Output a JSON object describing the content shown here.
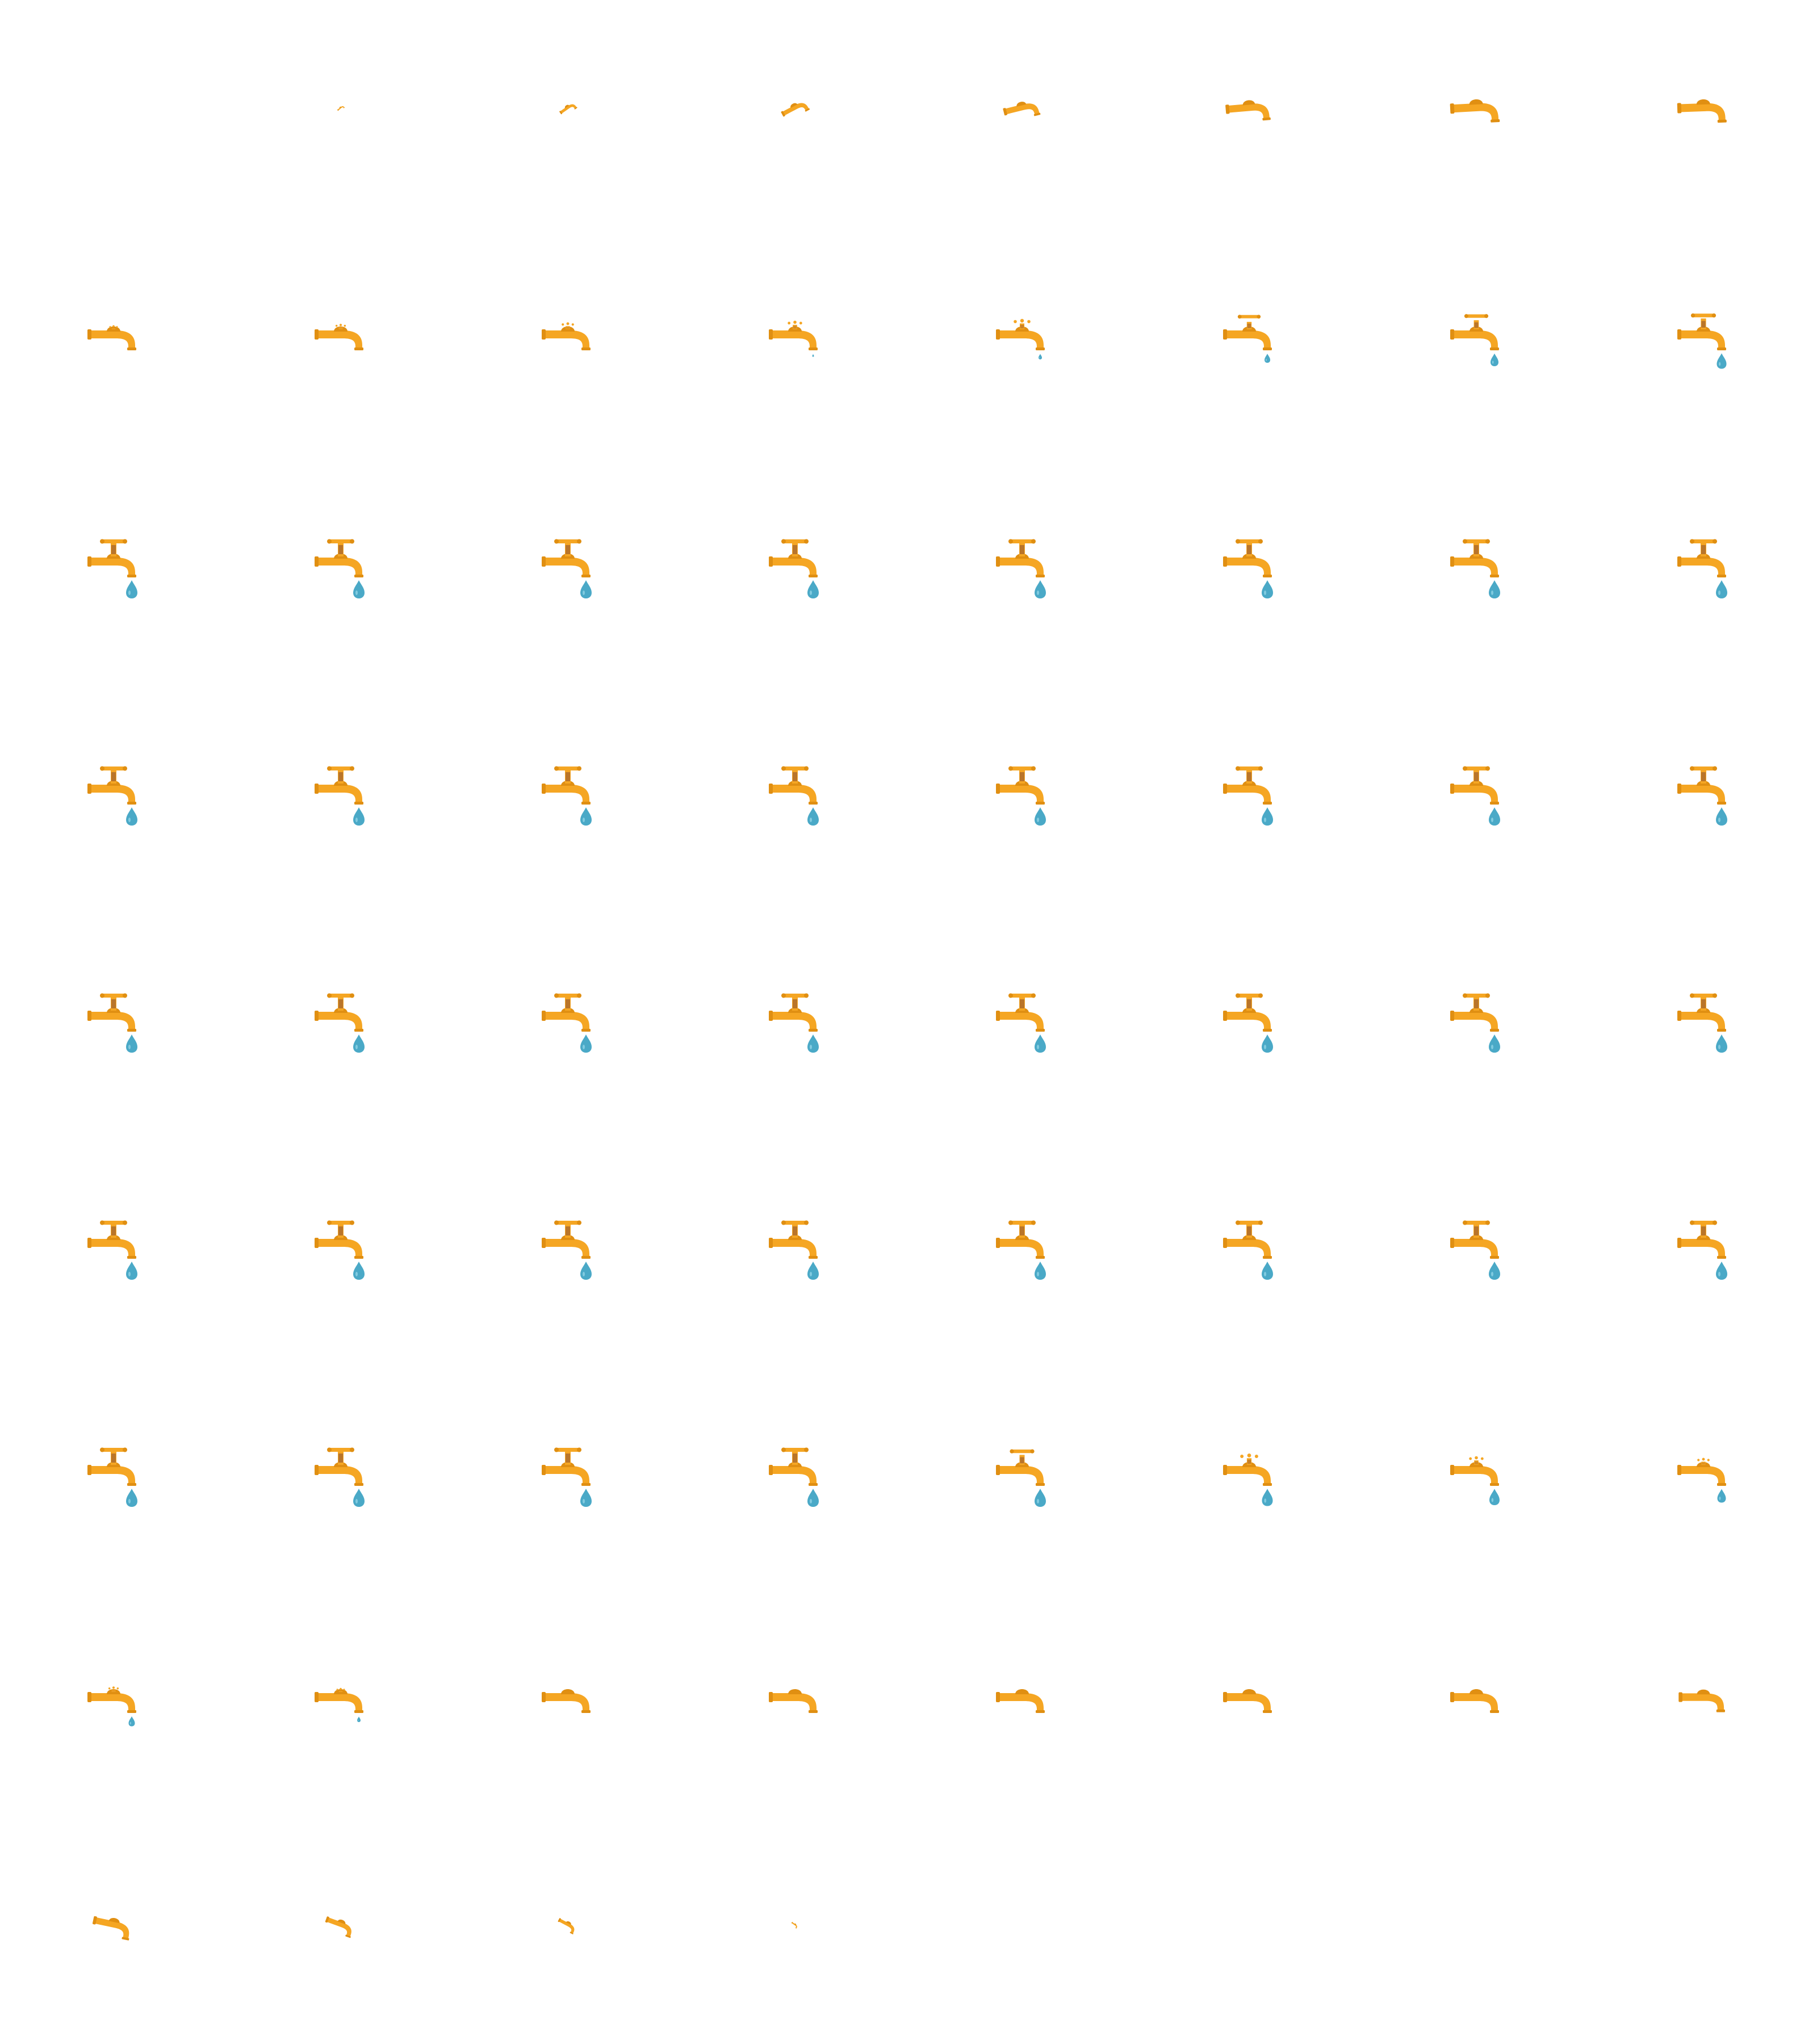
{
  "sprite_sheet": {
    "columns": 8,
    "rows": 9,
    "frame_count": 68,
    "colors": {
      "background": "#ffffff",
      "faucet_body": "#f5a623",
      "faucet_dark": "#e08f12",
      "valve_core": "#b9752b",
      "water": "#4aa9c7",
      "water_highlight": "#8fd3e6"
    },
    "phases": [
      {
        "name": "faucet-appears",
        "frames": [
          1,
          7
        ]
      },
      {
        "name": "valve-forms",
        "frames": [
          8,
          10
        ]
      },
      {
        "name": "drop-forms",
        "frames": [
          11,
          16
        ]
      },
      {
        "name": "steady-drip",
        "frames": [
          17,
          52
        ]
      },
      {
        "name": "drop-shrinks",
        "frames": [
          53,
          57
        ]
      },
      {
        "name": "faucet-disappears",
        "frames": [
          58,
          67
        ]
      }
    ],
    "frames": [
      {
        "n": 0,
        "scale": 0,
        "rot": -40,
        "handle": 0,
        "drop": 0
      },
      {
        "n": 1,
        "scale": 0.15,
        "rot": -40,
        "handle": 0,
        "drop": 0
      },
      {
        "n": 2,
        "scale": 0.35,
        "rot": -35,
        "handle": 0,
        "drop": 0
      },
      {
        "n": 3,
        "scale": 0.55,
        "rot": -28,
        "handle": 0,
        "drop": 0
      },
      {
        "n": 4,
        "scale": 0.72,
        "rot": -14,
        "handle": 0,
        "drop": 0
      },
      {
        "n": 5,
        "scale": 0.9,
        "rot": -5,
        "handle": 0,
        "drop": 0
      },
      {
        "n": 6,
        "scale": 1.0,
        "rot": -3,
        "handle": 0,
        "drop": 0
      },
      {
        "n": 7,
        "scale": 1.0,
        "rot": -2,
        "handle": 0,
        "drop": 0
      },
      {
        "n": 8,
        "scale": 1.0,
        "rot": 0,
        "handle": 0.1,
        "drop": 0
      },
      {
        "n": 9,
        "scale": 1.0,
        "rot": 0,
        "handle": 0.2,
        "drop": 0
      },
      {
        "n": 10,
        "scale": 1.0,
        "rot": 0,
        "handle": 0.3,
        "drop": 0
      },
      {
        "n": 11,
        "scale": 1.0,
        "rot": 0,
        "handle": 0.4,
        "drop": 0.15
      },
      {
        "n": 12,
        "scale": 1.0,
        "rot": 0,
        "handle": 0.5,
        "drop": 0.3
      },
      {
        "n": 13,
        "scale": 1.0,
        "rot": 0,
        "handle": 0.6,
        "drop": 0.5
      },
      {
        "n": 14,
        "scale": 1.0,
        "rot": 0,
        "handle": 0.7,
        "drop": 0.7
      },
      {
        "n": 15,
        "scale": 1.0,
        "rot": 0,
        "handle": 0.8,
        "drop": 0.85
      },
      {
        "n": 16,
        "scale": 1.0,
        "rot": 0,
        "handle": 1,
        "drop": 1
      },
      {
        "n": 17,
        "scale": 1.0,
        "rot": 0,
        "handle": 1,
        "drop": 1
      },
      {
        "n": 18,
        "scale": 1.0,
        "rot": 0,
        "handle": 1,
        "drop": 1
      },
      {
        "n": 19,
        "scale": 1.0,
        "rot": 0,
        "handle": 1,
        "drop": 1
      },
      {
        "n": 20,
        "scale": 1.0,
        "rot": 0,
        "handle": 1,
        "drop": 1
      },
      {
        "n": 21,
        "scale": 1.0,
        "rot": 0,
        "handle": 1,
        "drop": 1
      },
      {
        "n": 22,
        "scale": 1.0,
        "rot": 0,
        "handle": 1,
        "drop": 1
      },
      {
        "n": 23,
        "scale": 1.0,
        "rot": 0,
        "handle": 1,
        "drop": 1
      },
      {
        "n": 24,
        "scale": 1.0,
        "rot": 0,
        "handle": 1,
        "drop": 1
      },
      {
        "n": 25,
        "scale": 1.0,
        "rot": 0,
        "handle": 1,
        "drop": 1
      },
      {
        "n": 26,
        "scale": 1.0,
        "rot": 0,
        "handle": 1,
        "drop": 1
      },
      {
        "n": 27,
        "scale": 1.0,
        "rot": 0,
        "handle": 1,
        "drop": 1
      },
      {
        "n": 28,
        "scale": 1.0,
        "rot": 0,
        "handle": 1,
        "drop": 1
      },
      {
        "n": 29,
        "scale": 1.0,
        "rot": 0,
        "handle": 1,
        "drop": 1
      },
      {
        "n": 30,
        "scale": 1.0,
        "rot": 0,
        "handle": 1,
        "drop": 1
      },
      {
        "n": 31,
        "scale": 1.0,
        "rot": 0,
        "handle": 1,
        "drop": 1
      },
      {
        "n": 32,
        "scale": 1.0,
        "rot": 0,
        "handle": 1,
        "drop": 1
      },
      {
        "n": 33,
        "scale": 1.0,
        "rot": 0,
        "handle": 1,
        "drop": 1
      },
      {
        "n": 34,
        "scale": 1.0,
        "rot": 0,
        "handle": 1,
        "drop": 1
      },
      {
        "n": 35,
        "scale": 1.0,
        "rot": 0,
        "handle": 1,
        "drop": 1
      },
      {
        "n": 36,
        "scale": 1.0,
        "rot": 0,
        "handle": 1,
        "drop": 1
      },
      {
        "n": 37,
        "scale": 1.0,
        "rot": 0,
        "handle": 1,
        "drop": 1
      },
      {
        "n": 38,
        "scale": 1.0,
        "rot": 0,
        "handle": 1,
        "drop": 1
      },
      {
        "n": 39,
        "scale": 1.0,
        "rot": 0,
        "handle": 1,
        "drop": 1
      },
      {
        "n": 40,
        "scale": 1.0,
        "rot": 0,
        "handle": 1,
        "drop": 1
      },
      {
        "n": 41,
        "scale": 1.0,
        "rot": 0,
        "handle": 1,
        "drop": 1
      },
      {
        "n": 42,
        "scale": 1.0,
        "rot": 0,
        "handle": 1,
        "drop": 1
      },
      {
        "n": 43,
        "scale": 1.0,
        "rot": 0,
        "handle": 1,
        "drop": 1
      },
      {
        "n": 44,
        "scale": 1.0,
        "rot": 0,
        "handle": 1,
        "drop": 1
      },
      {
        "n": 45,
        "scale": 1.0,
        "rot": 0,
        "handle": 1,
        "drop": 1
      },
      {
        "n": 46,
        "scale": 1.0,
        "rot": 0,
        "handle": 1,
        "drop": 1
      },
      {
        "n": 47,
        "scale": 1.0,
        "rot": 0,
        "handle": 1,
        "drop": 1
      },
      {
        "n": 48,
        "scale": 1.0,
        "rot": 0,
        "handle": 1,
        "drop": 1
      },
      {
        "n": 49,
        "scale": 1.0,
        "rot": 0,
        "handle": 1,
        "drop": 1
      },
      {
        "n": 50,
        "scale": 1.0,
        "rot": 0,
        "handle": 1,
        "drop": 1
      },
      {
        "n": 51,
        "scale": 1.0,
        "rot": 0,
        "handle": 1,
        "drop": 1
      },
      {
        "n": 52,
        "scale": 1.0,
        "rot": 0,
        "handle": 0.75,
        "drop": 1
      },
      {
        "n": 53,
        "scale": 1.0,
        "rot": 0,
        "handle": 0.55,
        "drop": 0.95
      },
      {
        "n": 54,
        "scale": 1.0,
        "rot": 0,
        "handle": 0.4,
        "drop": 0.9
      },
      {
        "n": 55,
        "scale": 1.0,
        "rot": 0,
        "handle": 0.3,
        "drop": 0.75
      },
      {
        "n": 56,
        "scale": 1.0,
        "rot": 0,
        "handle": 0.2,
        "drop": 0.55
      },
      {
        "n": 57,
        "scale": 1.0,
        "rot": 0,
        "handle": 0.1,
        "drop": 0.3
      },
      {
        "n": 58,
        "scale": 1.0,
        "rot": 0,
        "handle": 0,
        "drop": 0
      },
      {
        "n": 59,
        "scale": 1.0,
        "rot": 0,
        "handle": 0,
        "drop": 0
      },
      {
        "n": 60,
        "scale": 1.0,
        "rot": 0,
        "handle": 0,
        "drop": 0
      },
      {
        "n": 61,
        "scale": 1.0,
        "rot": 0,
        "handle": 0,
        "drop": 0
      },
      {
        "n": 62,
        "scale": 1.0,
        "rot": 0,
        "handle": 0,
        "drop": 0
      },
      {
        "n": 63,
        "scale": 0.95,
        "rot": 0,
        "handle": 0,
        "drop": 0
      },
      {
        "n": 64,
        "scale": 0.8,
        "rot": 12,
        "handle": 0,
        "drop": 0
      },
      {
        "n": 65,
        "scale": 0.6,
        "rot": 20,
        "handle": 0,
        "drop": 0
      },
      {
        "n": 66,
        "scale": 0.4,
        "rot": 28,
        "handle": 0,
        "drop": 0
      },
      {
        "n": 67,
        "scale": 0.15,
        "rot": 35,
        "handle": 0,
        "drop": 0
      }
    ]
  }
}
